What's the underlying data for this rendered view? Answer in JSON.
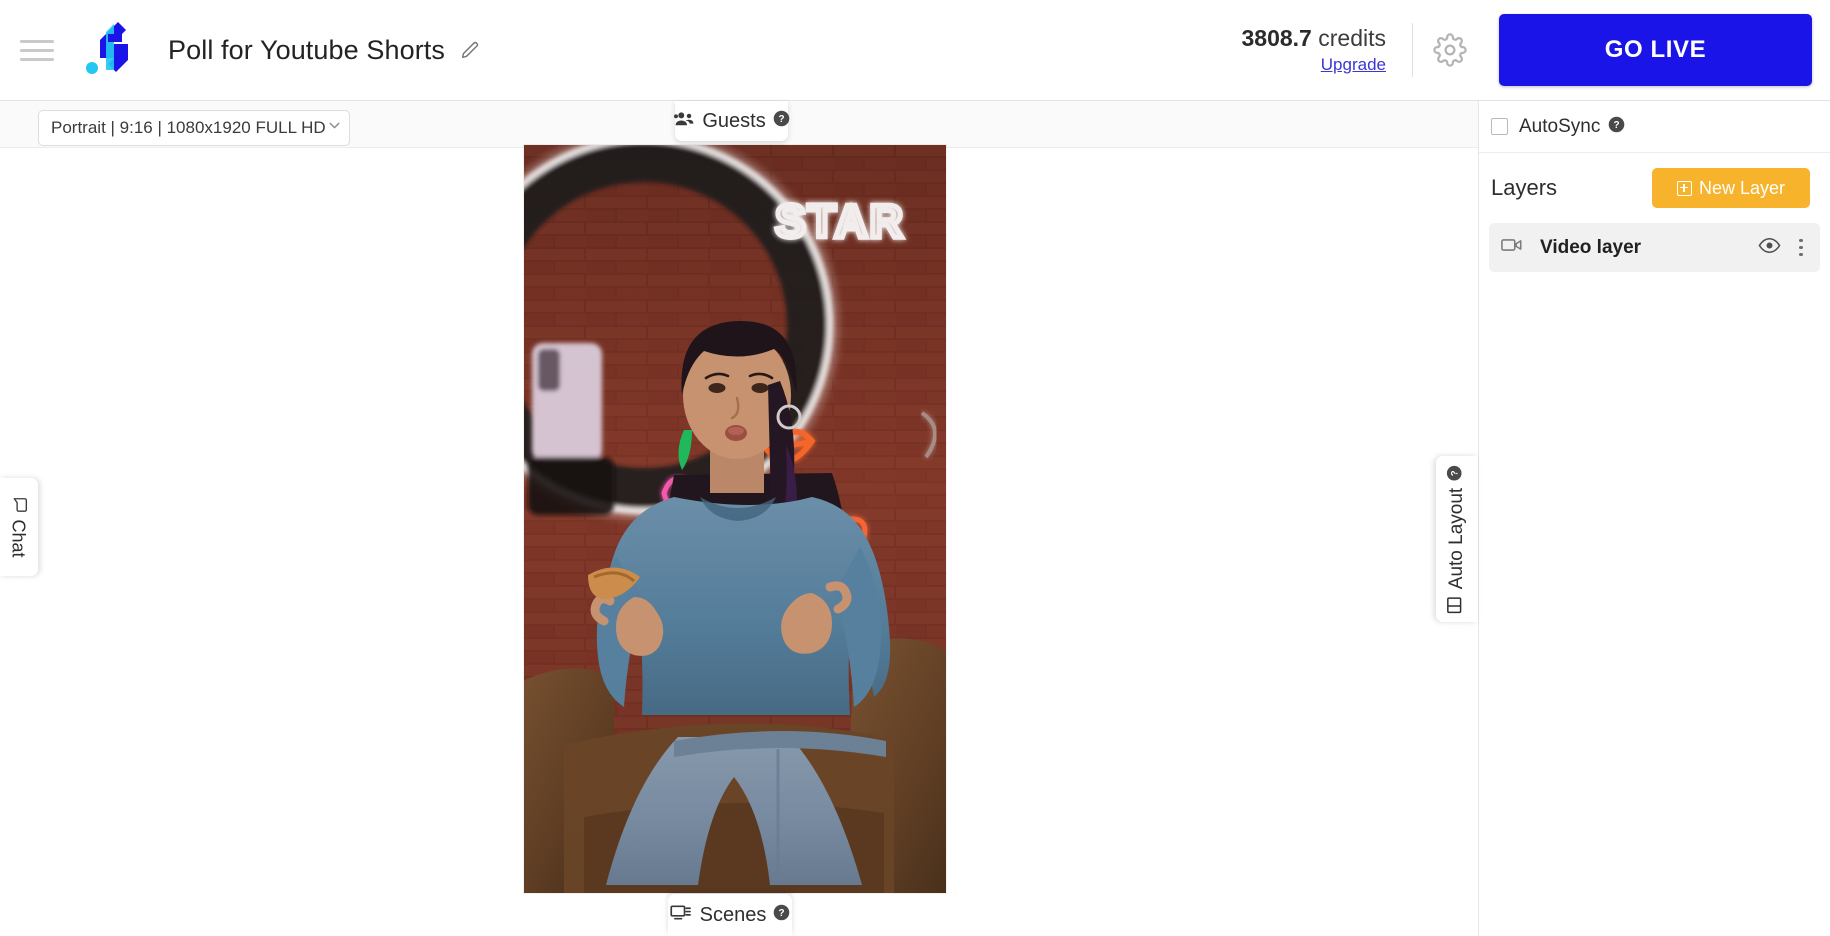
{
  "topbar": {
    "menu_icon": "hamburger-menu-icon",
    "logo_icon": "brand-logo-icon",
    "project_title": "Poll for Youtube Shorts",
    "edit_icon": "pencil-edit-icon",
    "credits_value": "3808.7",
    "credits_label": "credits",
    "upgrade_label": "Upgrade",
    "settings_icon": "gear-icon",
    "go_live_label": "GO LIVE",
    "go_live_color": "#1a14e8"
  },
  "subbar": {
    "resolution_value": "Portrait | 9:16 | 1080x1920 FULL HD",
    "dropdown_icon": "chevron-down-icon"
  },
  "tabs": {
    "guests_label": "Guests",
    "guests_icon": "people-group-icon",
    "guests_help_icon": "help-circle-icon",
    "scenes_label": "Scenes",
    "scenes_icon": "screens-icon",
    "scenes_help_icon": "help-circle-icon",
    "chat_label": "Chat",
    "chat_icon": "chat-bubble-icon",
    "auto_layout_label": "Auto Layout",
    "auto_layout_icon": "layout-grid-icon",
    "auto_layout_help_icon": "help-circle-icon"
  },
  "canvas": {
    "aspect": "9:16",
    "preview_alt": "Live video preview of person seated in armchair in front of brick wall with neon signs",
    "neon_text": "STAR"
  },
  "right_panel": {
    "autosync_label": "AutoSync",
    "autosync_checked": false,
    "autosync_help_icon": "help-circle-icon",
    "layers_title": "Layers",
    "new_layer_label": "New Layer",
    "new_layer_icon": "plus-square-icon",
    "new_layer_color": "#f7b32b",
    "layers": [
      {
        "name": "Video layer",
        "type_icon": "video-camera-icon",
        "visibility_icon": "eye-icon",
        "menu_icon": "vertical-dots-icon"
      }
    ]
  }
}
